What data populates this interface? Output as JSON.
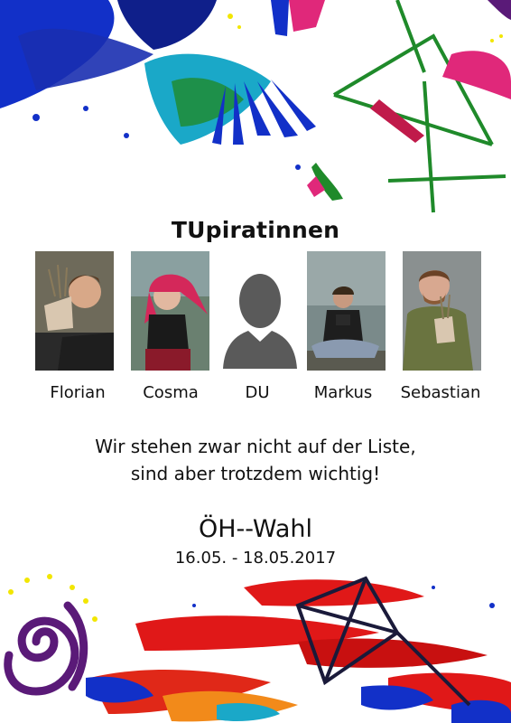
{
  "title": "TUpiratinnen",
  "members": [
    {
      "name": "Florian",
      "photo_icon": "person-holding-plant-photo"
    },
    {
      "name": "Cosma",
      "photo_icon": "person-red-hair-photo"
    },
    {
      "name": "DU",
      "photo_icon": "placeholder-person-icon"
    },
    {
      "name": "Markus",
      "photo_icon": "person-sitting-photo"
    },
    {
      "name": "Sebastian",
      "photo_icon": "person-holding-plant-photo"
    }
  ],
  "slogan": {
    "line1": "Wir stehen zwar nicht auf der Liste,",
    "line2": "sind aber trotzdem wichtig!"
  },
  "election": {
    "name": "ÖH--Wahl",
    "dates": "16.05. - 18.05.2017"
  },
  "colors": {
    "paint_blue": "#1230c8",
    "paint_teal": "#1aa8c8",
    "paint_green": "#1f8a2a",
    "paint_magenta": "#e0287a",
    "paint_red": "#e01818",
    "paint_purple": "#5a1a78",
    "paint_yellow": "#f2e600"
  }
}
